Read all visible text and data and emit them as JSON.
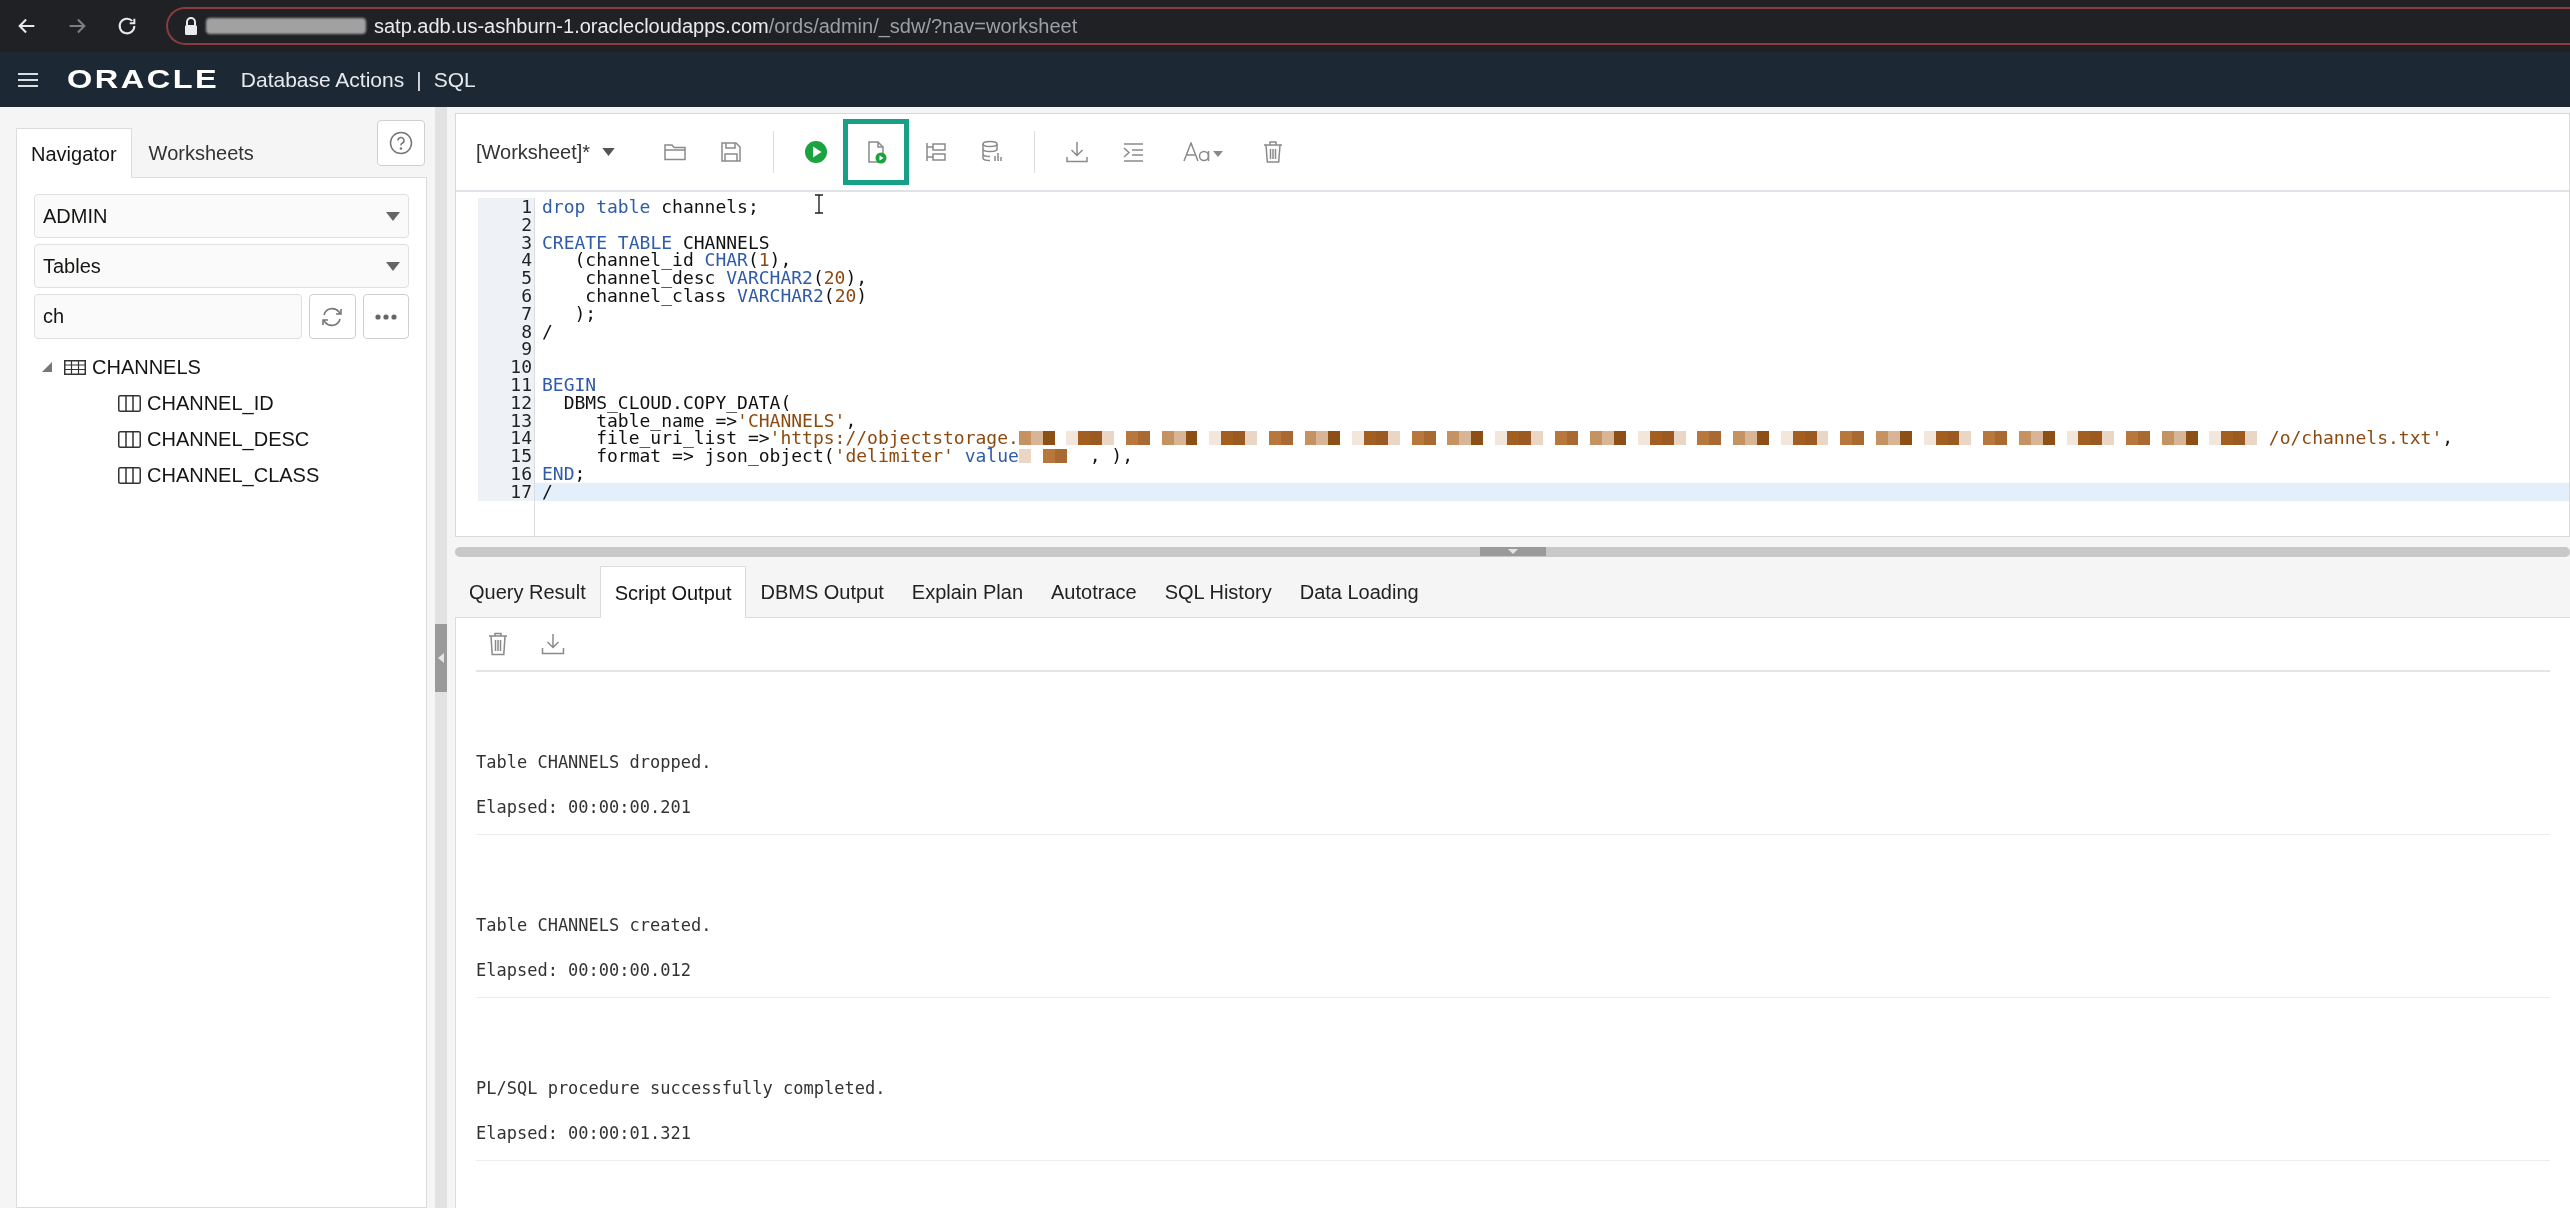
{
  "browser": {
    "url_host": "satp.adb.us-ashburn-1.oraclecloudapps.com",
    "url_path": "/ords/admin/_sdw/?nav=worksheet"
  },
  "header": {
    "logo": "ORACLE",
    "product": "Database Actions",
    "separator": "|",
    "page": "SQL"
  },
  "navigator": {
    "tabs": [
      {
        "label": "Navigator",
        "selected": true
      },
      {
        "label": "Worksheets",
        "selected": false
      }
    ],
    "schema": "ADMIN",
    "object_type": "Tables",
    "filter": "ch",
    "tree": [
      {
        "label": "CHANNELS",
        "expanded": true,
        "children": [
          {
            "label": "CHANNEL_ID"
          },
          {
            "label": "CHANNEL_DESC"
          },
          {
            "label": "CHANNEL_CLASS"
          }
        ]
      }
    ]
  },
  "worksheet": {
    "name": "[Worksheet]*",
    "toolbar": [
      {
        "kind": "open",
        "highlighted": false
      },
      {
        "kind": "save",
        "highlighted": false
      },
      {
        "kind": "divider",
        "highlighted": false
      },
      {
        "kind": "run",
        "highlighted": false
      },
      {
        "kind": "run_script",
        "highlighted": true
      },
      {
        "kind": "explain",
        "highlighted": false
      },
      {
        "kind": "autotrace",
        "highlighted": false
      },
      {
        "kind": "divider",
        "highlighted": false
      },
      {
        "kind": "download",
        "highlighted": false
      },
      {
        "kind": "format",
        "highlighted": false
      },
      {
        "kind": "font",
        "highlighted": false
      },
      {
        "kind": "clear",
        "highlighted": false
      }
    ]
  },
  "editor": {
    "lines": [
      {
        "number": "1",
        "current": false,
        "tokens": [
          {
            "kind": "keyword",
            "text": "drop"
          },
          {
            "kind": "keyword",
            "text": " table"
          },
          {
            "kind": "plain",
            "text": " channels;"
          }
        ]
      },
      {
        "number": "2",
        "current": false
      },
      {
        "number": "3",
        "current": false,
        "tokens": [
          {
            "kind": "keyword",
            "text": "CREATE"
          },
          {
            "kind": "keyword",
            "text": " TABLE"
          },
          {
            "kind": "plain",
            "text": " CHANNELS"
          }
        ]
      },
      {
        "number": "4",
        "current": false,
        "tokens": [
          {
            "kind": "plain",
            "text": "   (channel_id "
          },
          {
            "kind": "keyword",
            "text": "CHAR"
          },
          {
            "kind": "plain",
            "text": "("
          },
          {
            "kind": "number",
            "text": "1"
          },
          {
            "kind": "plain",
            "text": "),"
          }
        ]
      },
      {
        "number": "5",
        "current": false,
        "tokens": [
          {
            "kind": "plain",
            "text": "    channel_desc "
          },
          {
            "kind": "keyword",
            "text": "VARCHAR2"
          },
          {
            "kind": "plain",
            "text": "("
          },
          {
            "kind": "number",
            "text": "20"
          },
          {
            "kind": "plain",
            "text": "),"
          }
        ]
      },
      {
        "number": "6",
        "current": false,
        "tokens": [
          {
            "kind": "plain",
            "text": "    channel_class "
          },
          {
            "kind": "keyword",
            "text": "VARCHAR2"
          },
          {
            "kind": "plain",
            "text": "("
          },
          {
            "kind": "number",
            "text": "20"
          },
          {
            "kind": "plain",
            "text": ")"
          }
        ]
      },
      {
        "number": "7",
        "current": false,
        "tokens": [
          {
            "kind": "plain",
            "text": "   );"
          }
        ]
      },
      {
        "number": "8",
        "current": false,
        "tokens": [
          {
            "kind": "plain",
            "text": "/"
          }
        ]
      },
      {
        "number": "9",
        "current": false
      },
      {
        "number": "10",
        "current": false
      },
      {
        "number": "11",
        "current": false,
        "tokens": [
          {
            "kind": "keyword",
            "text": "BEGIN"
          }
        ]
      },
      {
        "number": "12",
        "current": false,
        "tokens": [
          {
            "kind": "plain",
            "text": "  DBMS_CLOUD.COPY_DATA("
          }
        ]
      },
      {
        "number": "13",
        "current": false,
        "tokens": [
          {
            "kind": "plain",
            "text": "     table_name =>"
          },
          {
            "kind": "string",
            "text": "'CHANNELS'"
          },
          {
            "kind": "plain",
            "text": ","
          }
        ]
      },
      {
        "number": "14",
        "current": false,
        "tokens": [
          {
            "kind": "plain",
            "text": "     file_uri_list =>"
          },
          {
            "kind": "string",
            "text": "'https://objectstorage."
          },
          {
            "kind": "redacted_long"
          },
          {
            "kind": "string",
            "text": "/o/channels.txt'"
          },
          {
            "kind": "plain",
            "text": ","
          }
        ]
      },
      {
        "number": "15",
        "current": false,
        "tokens": [
          {
            "kind": "plain",
            "text": "     format => json_object("
          },
          {
            "kind": "string",
            "text": "'delimiter'"
          },
          {
            "kind": "keyword",
            "text": " value"
          },
          {
            "kind": "redacted_short"
          },
          {
            "kind": "plain",
            "text": " , ),"
          }
        ]
      },
      {
        "number": "16",
        "current": false,
        "tokens": [
          {
            "kind": "keyword",
            "text": "END"
          },
          {
            "kind": "plain",
            "text": ";"
          }
        ]
      },
      {
        "number": "17",
        "current": true,
        "tokens": [
          {
            "kind": "plain",
            "text": "/"
          }
        ]
      }
    ]
  },
  "output_tabs": [
    {
      "label": "Query Result",
      "selected": false
    },
    {
      "label": "Script Output",
      "selected": true
    },
    {
      "label": "DBMS Output",
      "selected": false
    },
    {
      "label": "Explain Plan",
      "selected": false
    },
    {
      "label": "Autotrace",
      "selected": false
    },
    {
      "label": "SQL History",
      "selected": false
    },
    {
      "label": "Data Loading",
      "selected": false
    }
  ],
  "output": [
    {
      "message": "Table CHANNELS dropped.",
      "elapsed": "Elapsed: 00:00:00.201"
    },
    {
      "message": "Table CHANNELS created.",
      "elapsed": "Elapsed: 00:00:00.012"
    },
    {
      "message": "PL/SQL procedure successfully completed.",
      "elapsed": "Elapsed: 00:00:01.321"
    }
  ]
}
